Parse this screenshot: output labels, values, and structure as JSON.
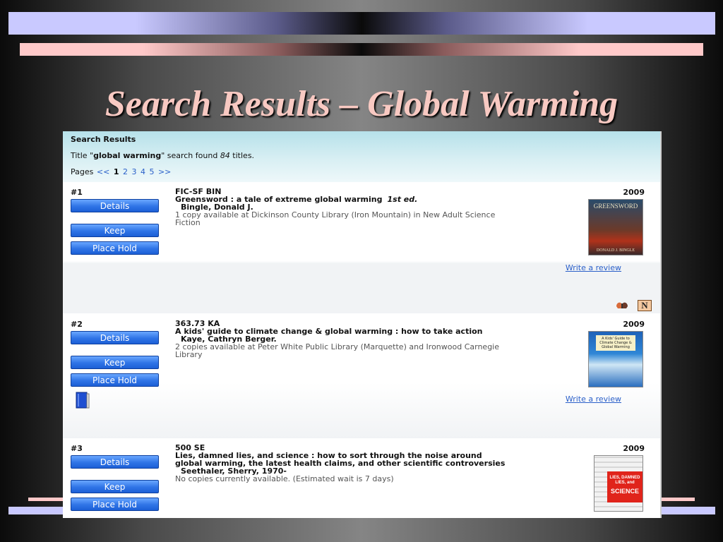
{
  "slide": {
    "title": "Search Results – Global Warming"
  },
  "results_header": {
    "heading": "Search Results",
    "summary_prefix": "Title \"",
    "query": "global warming",
    "summary_mid": "\" search found ",
    "count": "84",
    "summary_suffix": " titles.",
    "pages_label": "Pages",
    "prev": "<<",
    "pages": [
      "1",
      "2",
      "3",
      "4",
      "5"
    ],
    "current_page": "1",
    "next": ">>"
  },
  "buttons": {
    "details": "Details",
    "keep": "Keep",
    "place_hold": "Place Hold"
  },
  "records": [
    {
      "num": "#1",
      "call": "FIC-SF BIN",
      "title": "Greensword : a tale of extreme global warming",
      "edition": "1st ed.",
      "author": "Bingle, Donald J.",
      "availability": "1 copy available at Dickinson County Library (Iron Mountain) in New Adult Science Fiction",
      "year": "2009",
      "review": "Write a review",
      "cover_top": "GREENSWORD",
      "cover_bottom": "DONALD J. BINGLE"
    },
    {
      "num": "#2",
      "call": "363.73 KA",
      "title": "A kids' guide to climate change & global warming : how to take action",
      "author": "Kaye, Cathryn Berger.",
      "availability": "2 copies available at Peter White Public Library (Marquette) and Ironwood Carnegie Library",
      "year": "2009",
      "review": "Write a review",
      "cover_top": "A Kids' Guide to Climate Change & Global Warming"
    },
    {
      "num": "#3",
      "call": "500 SE",
      "title": "Lies, damned lies, and science : how to sort through the noise around global warming, the latest health claims, and other scientific controversies",
      "author": "Seethaler, Sherry, 1970-",
      "availability": "No copies currently available.   (Estimated wait is 7 days)",
      "year": "2009",
      "cover_top": "LIES, DAMNED LIES, and",
      "cover_bottom": "SCIENCE"
    }
  ],
  "colors": {
    "accent_button": "#2f74e6",
    "link": "#2a5fc9",
    "title": "#f8c9c2"
  }
}
